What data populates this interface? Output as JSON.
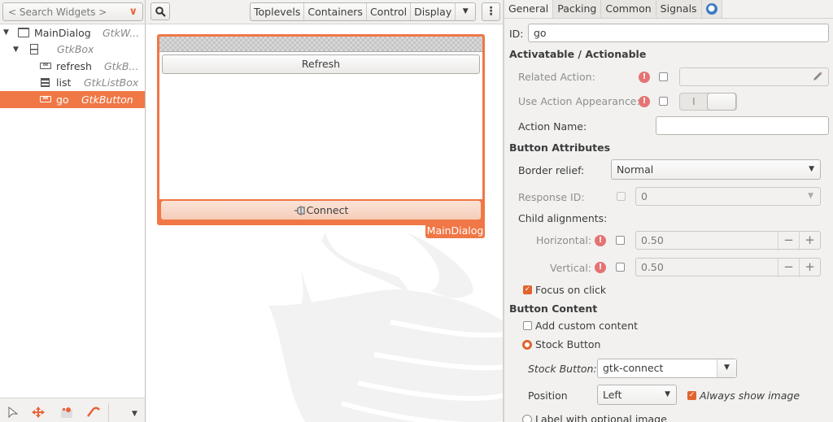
{
  "left_panel": {
    "search_placeholder": "< Search Widgets >",
    "tree": [
      {
        "name": "MainDialog",
        "type": "GtkW...",
        "icon": "window-icon",
        "level": 0,
        "expanded": true,
        "selected": false
      },
      {
        "name": "",
        "type": "GtkBox",
        "icon": "box-icon",
        "level": 1,
        "expanded": true,
        "selected": false
      },
      {
        "name": "refresh",
        "type": "GtkB...",
        "icon": "button-icon",
        "level": 2,
        "selected": false
      },
      {
        "name": "list",
        "type": "GtkListBox",
        "icon": "listbox-icon",
        "level": 2,
        "selected": false
      },
      {
        "name": "go",
        "type": "GtkButton",
        "icon": "button-icon",
        "level": 2,
        "selected": true
      }
    ],
    "bottom_tools": [
      "pointer-icon",
      "drag-resize-icon",
      "margin-edit-icon",
      "align-edit-icon"
    ],
    "icon_glyph_button": "ok"
  },
  "middle_panel": {
    "toolbar": {
      "search_icon": "search-icon",
      "categories": [
        "Toplevels",
        "Containers",
        "Control",
        "Display"
      ],
      "more_arrow": "▼",
      "menu_icon": "⋮"
    },
    "dialog": {
      "label": "MainDialog",
      "refresh_button": "Refresh",
      "connect_button": "Connect"
    }
  },
  "right_panel": {
    "tabs": [
      "General",
      "Packing",
      "Common",
      "Signals"
    ],
    "active_tab": "General",
    "id_label": "ID:",
    "id_value": "go",
    "section_actionable": "Activatable / Actionable",
    "related_action_label": "Related Action:",
    "related_action_value": "",
    "use_action_appearance_label": "Use Action Appearance:",
    "switch_off_glyph": "I",
    "action_name_label": "Action Name:",
    "action_name_value": "",
    "section_button_attrs": "Button Attributes",
    "border_relief_label": "Border relief:",
    "border_relief_value": "Normal",
    "response_id_label": "Response ID:",
    "response_id_value": "0",
    "child_alignments_label": "Child alignments:",
    "horizontal_label": "Horizontal:",
    "horizontal_value": "0.50",
    "vertical_label": "Vertical:",
    "vertical_value": "0.50",
    "focus_on_click_label": "Focus on click",
    "focus_on_click": true,
    "section_button_content": "Button Content",
    "add_custom_content_label": "Add custom content",
    "add_custom_content": false,
    "stock_button_radio_label": "Stock Button",
    "stock_button_label": "Stock Button:",
    "stock_button_value": "gtk-connect",
    "position_label": "Position",
    "position_value": "Left",
    "always_show_image_label": "Always show image",
    "always_show_image": true,
    "label_with_image_label": "Label with optional image",
    "spin_minus": "−",
    "spin_plus": "+",
    "warn_glyph": "!",
    "check_glyph": "✓"
  },
  "colors": {
    "accent": "#f07746",
    "check": "#e0642e",
    "warning": "#e57373",
    "a11y": "#3d7ac4"
  }
}
